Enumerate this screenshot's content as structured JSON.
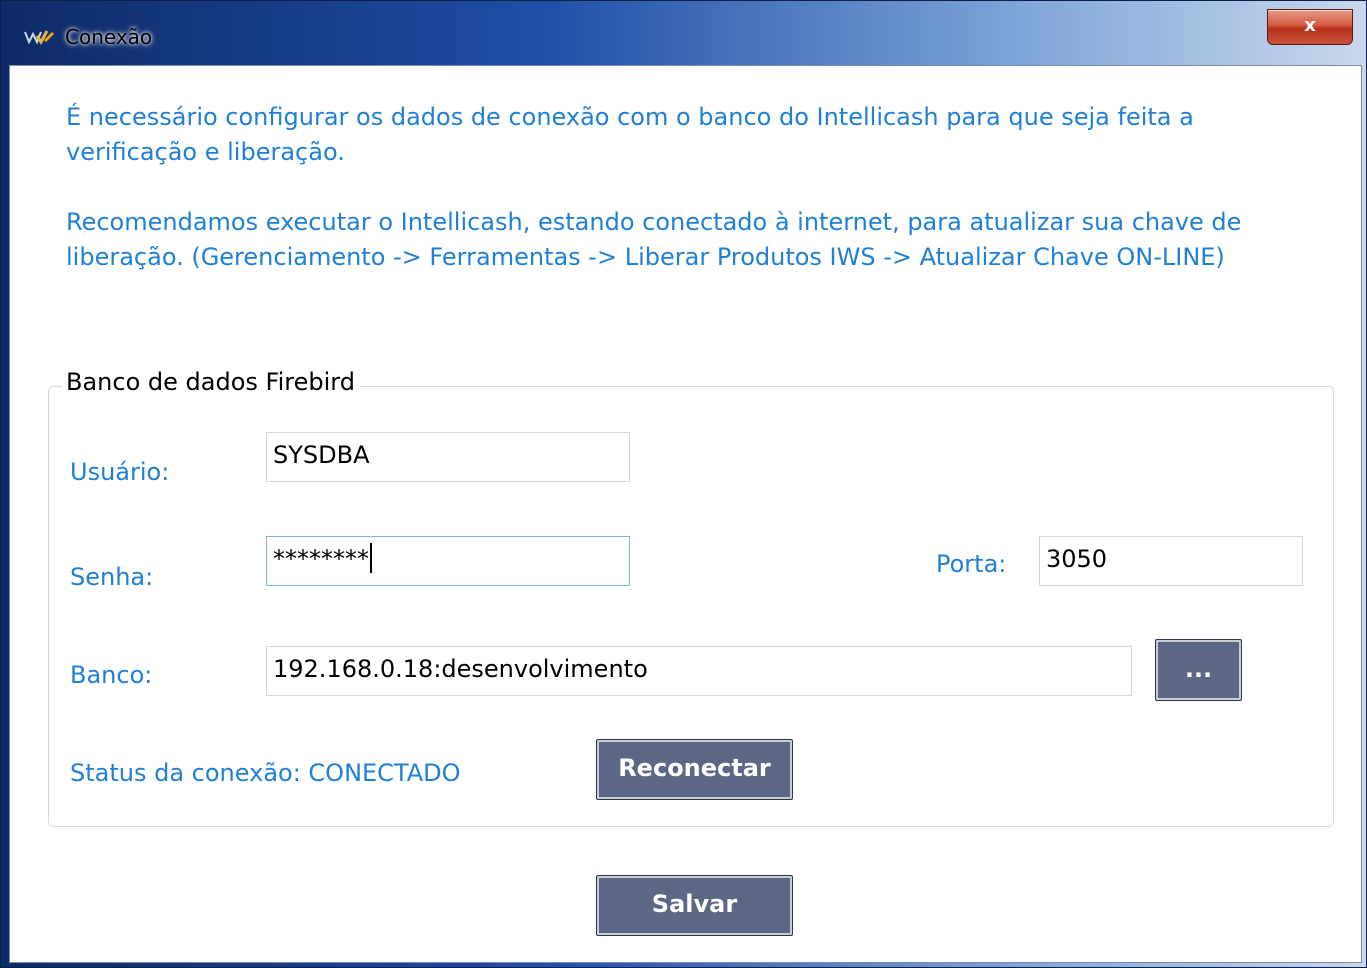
{
  "window": {
    "title": "Conexão",
    "close_label": "x"
  },
  "intro": {
    "line1": "É necessário configurar os dados de conexão com o banco do Intellicash para que seja feita a verificação e liberação.",
    "line2": "Recomendamos executar o Intellicash, estando conectado à internet, para atualizar sua chave de liberação. (Gerenciamento -> Ferramentas -> Liberar Produtos IWS -> Atualizar Chave ON-LINE)"
  },
  "group": {
    "legend": "Banco de dados Firebird"
  },
  "fields": {
    "usuario_label": "Usuário:",
    "usuario_value": "SYSDBA",
    "senha_label": "Senha:",
    "senha_value": "********",
    "porta_label": "Porta:",
    "porta_value": "3050",
    "banco_label": "Banco:",
    "banco_value": "192.168.0.18:desenvolvimento"
  },
  "status": {
    "text": "Status da conexão: CONECTADO"
  },
  "buttons": {
    "browse_label": "...",
    "reconnect_label": "Reconectar",
    "save_label": "Salvar"
  },
  "colors": {
    "accent_text": "#1f80d6",
    "button_bg": "#5b6784",
    "close_button": "#c9553a"
  }
}
